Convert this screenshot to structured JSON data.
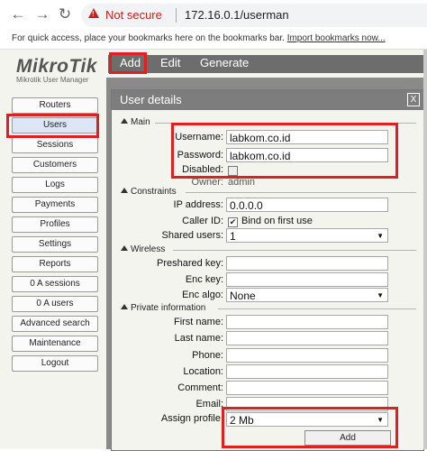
{
  "browser": {
    "back": "←",
    "forward": "→",
    "reload": "↻",
    "security": "Not secure",
    "url": "172.16.0.1/userman",
    "bookmarks_text": "For quick access, place your bookmarks here on the bookmarks bar.",
    "bookmarks_link": "Import bookmarks now..."
  },
  "logo": {
    "title": "MikroTik",
    "subtitle": "Mikrotik User Manager"
  },
  "topbar": {
    "items": [
      "Add",
      "Edit",
      "Generate"
    ]
  },
  "sidebar": {
    "items": [
      "Routers",
      "Users",
      "Sessions",
      "Customers",
      "Logs",
      "Payments",
      "Profiles",
      "Settings",
      "Reports",
      "0 A sessions",
      "0 A users",
      "Advanced search",
      "Maintenance",
      "Logout"
    ],
    "active_index": 1
  },
  "dialog": {
    "title": "User details",
    "close": "X",
    "sections": {
      "main": "Main",
      "constraints": "Constraints",
      "wireless": "Wireless",
      "private": "Private information"
    },
    "main": {
      "username_label": "Username:",
      "username_value": "labkom.co.id",
      "password_label": "Password:",
      "password_value": "labkom.co.id",
      "disabled_label": "Disabled:",
      "owner_label": "Owner:",
      "owner_value": "admin"
    },
    "constraints": {
      "ip_label": "IP address:",
      "ip_value": "0.0.0.0",
      "caller_label": "Caller ID:",
      "caller_text": "Bind on first use",
      "shared_label": "Shared users:",
      "shared_value": "1"
    },
    "wireless": {
      "psk_label": "Preshared key:",
      "psk_value": "",
      "enc_key_label": "Enc key:",
      "enc_key_value": "",
      "enc_algo_label": "Enc algo:",
      "enc_algo_value": "None"
    },
    "private": {
      "first_label": "First name:",
      "last_label": "Last name:",
      "phone_label": "Phone:",
      "location_label": "Location:",
      "comment_label": "Comment:",
      "email_label": "Email:",
      "profile_label": "Assign profile:",
      "profile_value": "2 Mb"
    },
    "add_button": "Add"
  },
  "colors": {
    "highlight": "#e01e24",
    "header": "#6d6d6d",
    "warning": "#c5221f"
  }
}
